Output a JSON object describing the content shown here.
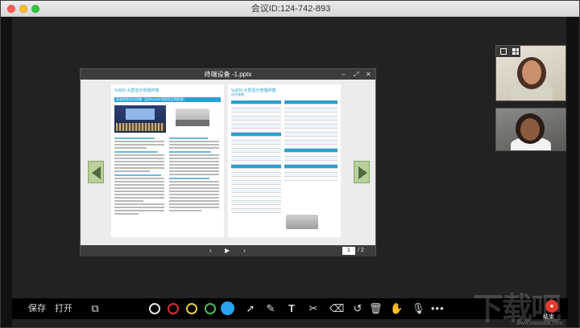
{
  "window": {
    "title": "会议ID:124-742-893"
  },
  "viewer": {
    "title": "终端设备 -1.pptx",
    "controls": {
      "minimize": "–",
      "maximize": "⤢",
      "close": "✕"
    },
    "page_current": "1",
    "page_total": "/ 2",
    "nav": {
      "prev": "‹",
      "play": "▶",
      "next": "›"
    },
    "left_page": {
      "heading": "Vy600 大屏显示管理终端",
      "subheading": "高清视频会议终端（支持1080P视频及无线投屏）"
    },
    "right_page": {
      "heading": "Vy600 大屏显示管理终端",
      "subheading": "技术参数"
    }
  },
  "toolbar": {
    "save_label": "保存",
    "open_label": "打开",
    "pen_colors": [
      "#e8e8e8",
      "#e02d2d",
      "#e6d03a",
      "#4bbf58",
      "#27a4f2"
    ],
    "record_label": "结束"
  },
  "watermark": {
    "text": "下载吧",
    "sub": "www.xiazaiba.com"
  }
}
